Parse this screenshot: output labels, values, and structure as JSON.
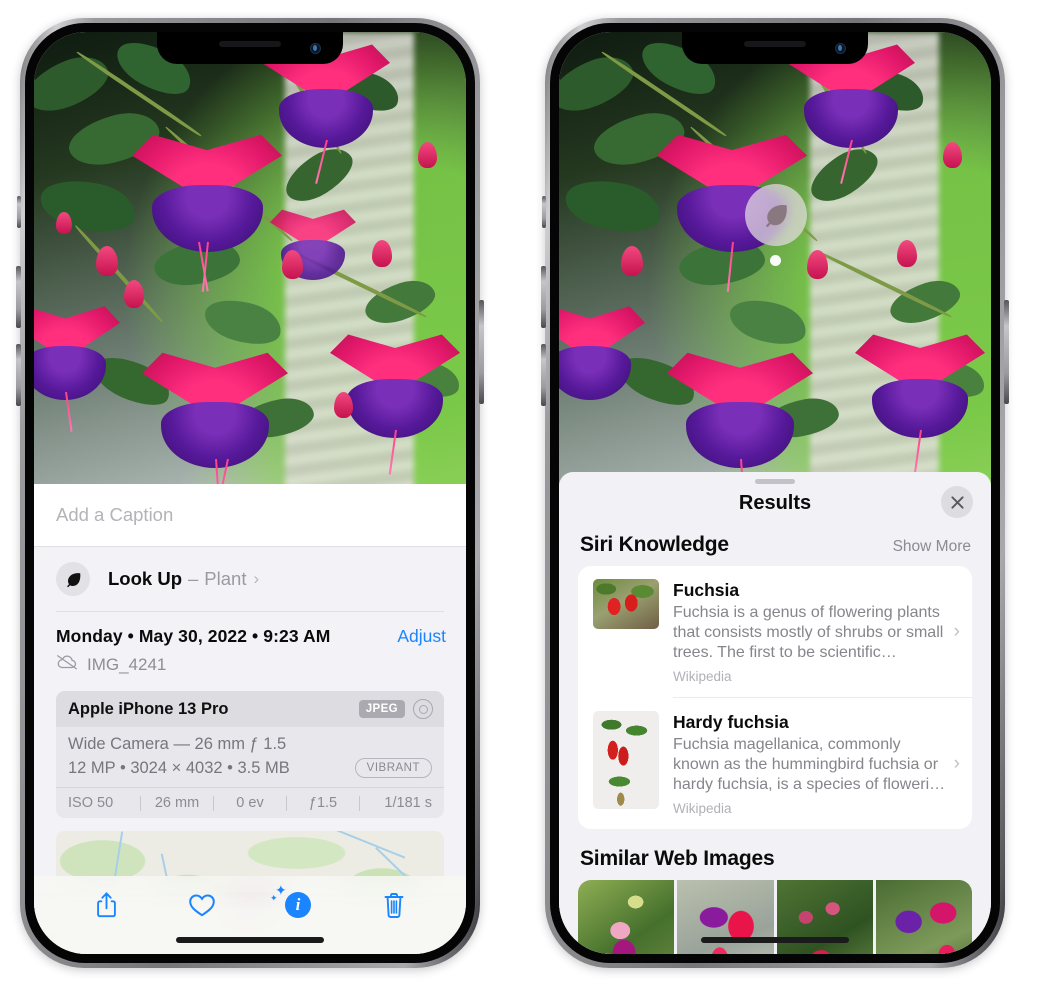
{
  "left_phone": {
    "photo": {
      "alt": "fuchsia-flowers-photo"
    },
    "caption": {
      "placeholder": "Add a Caption",
      "value": ""
    },
    "look_up": {
      "icon": "leaf-icon",
      "title": "Look Up",
      "dash": "–",
      "kind": "Plant",
      "chevron": "›"
    },
    "date_row": {
      "date": "Monday • May 30, 2022 • 9:23 AM",
      "adjust_label": "Adjust",
      "cloud_icon": "icloud-slash-icon",
      "file_name": "IMG_4241"
    },
    "exif": {
      "device": "Apple iPhone 13 Pro",
      "format_badge": "JPEG",
      "lens_icon": "aperture-icon",
      "lens_line": "Wide Camera — 26 mm ƒ 1.5",
      "specs_line": "12 MP • 3024 × 4032 • 3.5 MB",
      "style_badge": "VIBRANT",
      "settings": [
        "ISO 50",
        "26 mm",
        "0 ev",
        "ƒ1.5",
        "1/181 s"
      ]
    },
    "map": {
      "name": "location-map-card",
      "pin": "photo-thumbnail-pin"
    },
    "toolbar": [
      {
        "name": "share-button",
        "icon": "share-icon"
      },
      {
        "name": "favorite-button",
        "icon": "heart-icon"
      },
      {
        "name": "info-button",
        "icon": "info-sparkle-icon"
      },
      {
        "name": "delete-button",
        "icon": "trash-icon"
      }
    ]
  },
  "right_phone": {
    "photo": {
      "alt": "fuchsia-flowers-photo"
    },
    "vlu_badge": {
      "icon": "leaf-icon",
      "label": "Visual Look Up"
    },
    "sheet": {
      "title": "Results",
      "close_label": "×",
      "siri_knowledge": {
        "title": "Siri Knowledge",
        "show_more": "Show More",
        "items": [
          {
            "name": "Fuchsia",
            "description": "Fuchsia is a genus of flowering plants that consists mostly of shrubs or small trees. The first to be scientific…",
            "source": "Wikipedia",
            "chevron": "›",
            "thumb": "fuchsia-thumbnail"
          },
          {
            "name": "Hardy fuchsia",
            "description": "Fuchsia magellanica, commonly known as the hummingbird fuchsia or hardy fuchsia, is a species of floweri…",
            "source": "Wikipedia",
            "chevron": "›",
            "thumb": "hardy-fuchsia-thumbnail"
          }
        ]
      },
      "similar_web_images": {
        "title": "Similar Web Images",
        "items": [
          {
            "name": "web-image-1"
          },
          {
            "name": "web-image-2"
          },
          {
            "name": "web-image-3"
          },
          {
            "name": "web-image-4"
          }
        ]
      }
    }
  },
  "colors": {
    "accent_blue": "#1b84ff",
    "sheet_bg": "#f1f1f6",
    "card_bg": "#ffffff",
    "secondary_text": "#8e8e93"
  }
}
